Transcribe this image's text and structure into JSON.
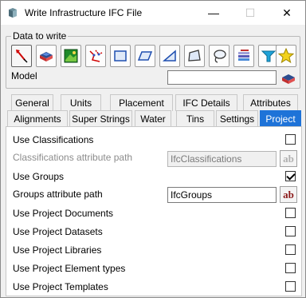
{
  "window": {
    "title": "Write Infrastructure IFC File",
    "minimize_glyph": "—",
    "maximize_glyph": "☐",
    "close_glyph": "✕"
  },
  "data_to_write": {
    "label": "Data to write",
    "tools": [
      {
        "name": "points-tool-icon"
      },
      {
        "name": "tin-surface-tool-icon"
      },
      {
        "name": "image-tool-icon"
      },
      {
        "name": "lines-tool-icon"
      },
      {
        "name": "rectangle-tool-icon"
      },
      {
        "name": "parallelogram-tool-icon"
      },
      {
        "name": "triangle-tool-icon"
      },
      {
        "name": "polygon-tool-icon"
      },
      {
        "name": "lasso-tool-icon"
      },
      {
        "name": "layers-tool-icon"
      },
      {
        "name": "funnel-tool-icon"
      },
      {
        "name": "star-tool-icon"
      }
    ],
    "model_label": "Model",
    "model_value": ""
  },
  "tabs": {
    "row1": [
      "General",
      "Units",
      "Placement",
      "IFC Details",
      "Attributes"
    ],
    "row2": [
      "Alignments",
      "Super Strings",
      "Water",
      "Tins",
      "Settings",
      "Project"
    ],
    "active": "Project"
  },
  "project": {
    "use_classifications": {
      "label": "Use Classifications",
      "checked": false
    },
    "classifications_path": {
      "label": "Classifications attribute path",
      "value": "IfcClassifications",
      "enabled": false
    },
    "use_groups": {
      "label": "Use Groups",
      "checked": true
    },
    "groups_path": {
      "label": "Groups attribute path",
      "value": "IfcGroups",
      "enabled": true
    },
    "use_documents": {
      "label": "Use Project Documents",
      "checked": false
    },
    "use_datasets": {
      "label": "Use Project Datasets",
      "checked": false
    },
    "use_libraries": {
      "label": "Use Project Libraries",
      "checked": false
    },
    "use_element_types": {
      "label": "Use Project Element types",
      "checked": false
    },
    "use_templates": {
      "label": "Use Project Templates",
      "checked": false
    },
    "ab_button_label": "ab"
  },
  "colors": {
    "active_tab": "#1e73d8",
    "ab_text": "#8b1a1a"
  }
}
